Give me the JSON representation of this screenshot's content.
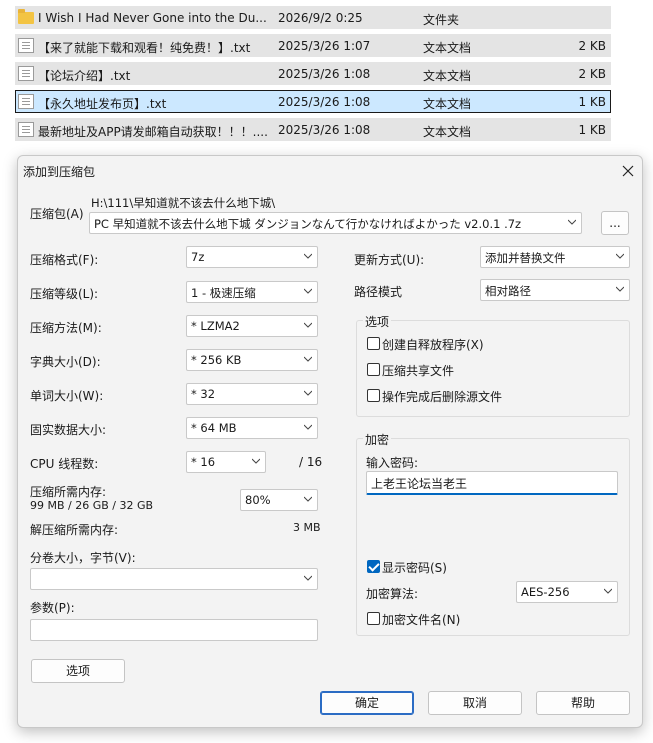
{
  "files": [
    {
      "icon": "folder-icon",
      "name": "I Wish I Had Never Gone into the Du...",
      "date": "2026/9/2 0:25",
      "type": "文件夹",
      "size": "",
      "selected": false
    },
    {
      "icon": "text-file-icon",
      "name": "【来了就能下载和观看！纯免费！】.txt",
      "date": "2025/3/26 1:07",
      "type": "文本文档",
      "size": "2 KB",
      "selected": false
    },
    {
      "icon": "text-file-icon",
      "name": "【论坛介绍】.txt",
      "date": "2025/3/26 1:08",
      "type": "文本文档",
      "size": "2 KB",
      "selected": false
    },
    {
      "icon": "text-file-icon",
      "name": "【永久地址发布页】.txt",
      "date": "2025/3/26 1:08",
      "type": "文本文档",
      "size": "1 KB",
      "selected": true
    },
    {
      "icon": "text-file-icon",
      "name": "最新地址及APP请发邮箱自动获取！！！....",
      "date": "2025/3/26 1:08",
      "type": "文本文档",
      "size": "1 KB",
      "selected": false
    }
  ],
  "dialog": {
    "title": "添加到压缩包",
    "archive_label": "压缩包(A)",
    "archive_path": "H:\\111\\早知道就不该去什么地下城\\",
    "archive_name": "PC 早知道就不该去什么地下城 ダンジョンなんて行かなければよかった v2.0.1 .7z",
    "browse_label": "...",
    "format_label": "压缩格式(F):",
    "format_value": "7z",
    "level_label": "压缩等级(L):",
    "level_value": "1 - 极速压缩",
    "method_label": "压缩方法(M):",
    "method_value": "*  LZMA2",
    "dict_label": "字典大小(D):",
    "dict_value": "*  256 KB",
    "word_label": "单词大小(W):",
    "word_value": "*  32",
    "solid_label": "固实数据大小:",
    "solid_value": "*  64 MB",
    "cpu_label": "CPU 线程数:",
    "cpu_value": "*  16",
    "cpu_total": "/ 16",
    "mem_label": "压缩所需内存:",
    "mem_detail": "99 MB / 26 GB / 32 GB",
    "mem_pct": "80%",
    "decomp_label": "解压缩所需内存:",
    "decomp_value": "3 MB",
    "split_label": "分卷大小，字节(V):",
    "split_value": "",
    "params_label": "参数(P):",
    "params_value": "",
    "options_button": "选项",
    "update_label": "更新方式(U):",
    "update_value": "添加并替换文件",
    "pathmode_label": "路径模式",
    "pathmode_value": "相对路径",
    "options_group": "选项",
    "opt_sfx": "创建自释放程序(X)",
    "opt_shared": "压缩共享文件",
    "opt_delete": "操作完成后删除源文件",
    "encrypt_group": "加密",
    "password_label": "输入密码:",
    "password_value": "上老王论坛当老王",
    "show_password": "显示密码(S)",
    "enc_method_label": "加密算法:",
    "enc_method_value": "AES-256",
    "enc_names": "加密文件名(N)",
    "ok": "确定",
    "cancel": "取消",
    "help": "帮助"
  },
  "colors": {
    "accent": "#0067c0",
    "selection": "#cce8ff",
    "row_bg": "#e4e4e4"
  }
}
